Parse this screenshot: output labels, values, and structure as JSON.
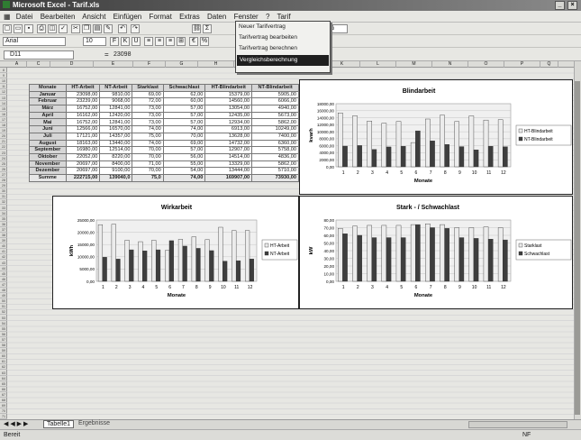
{
  "window": {
    "title": "Microsoft Excel - Tarif.xls",
    "min": "_",
    "close": "×"
  },
  "menu": {
    "items": [
      "Datei",
      "Bearbeiten",
      "Ansicht",
      "Einfügen",
      "Format",
      "Extras",
      "Daten",
      "Fenster",
      "?",
      "Tarif"
    ]
  },
  "dropdown": {
    "items": [
      "Neuer Tarifvertrag",
      "Tarifvertrag bearbeiten",
      "Tarifvertrag berechnen",
      "Vergleichsberechnung"
    ],
    "selected_index": 3
  },
  "toolbar": {
    "font": "Arial",
    "size": "10",
    "zoom": "%"
  },
  "formula": {
    "cell": "D11",
    "fx": "=",
    "value": "23098"
  },
  "columns": [
    "A",
    "C",
    "D",
    "E",
    "F",
    "G",
    "H",
    "I",
    "J",
    "K",
    "L",
    "M",
    "N",
    "O",
    "P",
    "Q"
  ],
  "table": {
    "headers": [
      "Monate",
      "HT-Arbeit",
      "NT-Arbeit",
      "Starklast",
      "Schwachlast",
      "HT-Blindarbeit",
      "NT-Blindarbeit"
    ],
    "rows": [
      [
        "Januar",
        "23098,00",
        "9810,00",
        "69,00",
        "62,00",
        "15379,00",
        "5905,00"
      ],
      [
        "Februar",
        "23239,00",
        "9068,00",
        "72,00",
        "60,00",
        "14560,00",
        "6066,00"
      ],
      [
        "März",
        "16752,00",
        "12841,00",
        "73,00",
        "57,00",
        "13054,00",
        "4940,00"
      ],
      [
        "April",
        "16162,00",
        "12420,00",
        "73,00",
        "57,00",
        "12435,00",
        "5673,00"
      ],
      [
        "Mai",
        "16752,00",
        "12841,00",
        "73,00",
        "57,00",
        "12934,00",
        "5862,00"
      ],
      [
        "Juni",
        "12566,00",
        "16570,00",
        "74,00",
        "74,00",
        "6913,00",
        "10249,00"
      ],
      [
        "Juli",
        "17121,00",
        "14357,00",
        "75,00",
        "70,00",
        "13628,00",
        "7400,00"
      ],
      [
        "August",
        "18163,00",
        "13440,00",
        "74,00",
        "69,00",
        "14732,00",
        "6360,00"
      ],
      [
        "September",
        "16980,00",
        "12514,00",
        "70,00",
        "57,00",
        "12907,00",
        "5758,00"
      ],
      [
        "Oktober",
        "22052,00",
        "8220,00",
        "70,00",
        "56,00",
        "14514,00",
        "4836,00"
      ],
      [
        "November",
        "20697,00",
        "8400,00",
        "71,00",
        "55,00",
        "13329,00",
        "5862,00"
      ],
      [
        "Dezember",
        "20697,00",
        "9100,00",
        "70,00",
        "54,00",
        "13444,00",
        "5710,00"
      ]
    ],
    "sum": [
      "Summe",
      "222715,00",
      "139040,0",
      "75,0",
      "74,00",
      "169907,00",
      "73930,00"
    ]
  },
  "chart_data": [
    {
      "type": "bar",
      "title": "Blindarbeit",
      "xlabel": "Monate",
      "ylabel": "kvarh",
      "categories": [
        "1",
        "2",
        "3",
        "4",
        "5",
        "6",
        "7",
        "8",
        "9",
        "10",
        "11",
        "12"
      ],
      "ylim": [
        0,
        18000
      ],
      "yticks": [
        "0,00",
        "2000,00",
        "4000,00",
        "6000,00",
        "8000,00",
        "10000,00",
        "12000,00",
        "14000,00",
        "16000,00",
        "18000,00"
      ],
      "series": [
        {
          "name": "HT-Blindarbeit",
          "values": [
            15379,
            14560,
            13054,
            12435,
            12934,
            6913,
            13628,
            14732,
            12907,
            14514,
            13329,
            13444
          ]
        },
        {
          "name": "NT-Blindarbeit",
          "values": [
            5905,
            6066,
            4940,
            5673,
            5862,
            10249,
            7400,
            6360,
            5758,
            4836,
            5862,
            5710
          ]
        }
      ]
    },
    {
      "type": "bar",
      "title": "Wirkarbeit",
      "xlabel": "Monate",
      "ylabel": "kWh",
      "categories": [
        "1",
        "2",
        "3",
        "4",
        "5",
        "6",
        "7",
        "8",
        "9",
        "10",
        "11",
        "12"
      ],
      "ylim": [
        0,
        25000
      ],
      "yticks": [
        "0,00",
        "5000,00",
        "10000,00",
        "15000,00",
        "20000,00",
        "25000,00"
      ],
      "series": [
        {
          "name": "HT-Arbeit",
          "values": [
            23098,
            23239,
            16752,
            16162,
            16752,
            12566,
            17121,
            18163,
            16980,
            22052,
            20697,
            20697
          ]
        },
        {
          "name": "NT-Arbeit",
          "values": [
            9810,
            9068,
            12841,
            12420,
            12841,
            16570,
            14357,
            13440,
            12514,
            8220,
            8400,
            9100
          ]
        }
      ]
    },
    {
      "type": "bar",
      "title": "Stark - / Schwachlast",
      "xlabel": "Monate",
      "ylabel": "kW",
      "categories": [
        "1",
        "2",
        "3",
        "4",
        "5",
        "6",
        "7",
        "8",
        "9",
        "10",
        "11",
        "12"
      ],
      "ylim": [
        0,
        80
      ],
      "yticks": [
        "0,00",
        "10,00",
        "20,00",
        "30,00",
        "40,00",
        "50,00",
        "60,00",
        "70,00",
        "80,00"
      ],
      "series": [
        {
          "name": "Starklast",
          "values": [
            69,
            72,
            73,
            73,
            73,
            74,
            75,
            74,
            70,
            70,
            71,
            70
          ]
        },
        {
          "name": "Schwachlast",
          "values": [
            62,
            60,
            57,
            57,
            57,
            74,
            70,
            69,
            57,
            56,
            55,
            54
          ]
        }
      ]
    }
  ],
  "colors": {
    "light_bar": "#ececec",
    "dark_bar": "#3e3e3e"
  },
  "tabs": {
    "active": "Tabelle1",
    "other": "Ergebnisse"
  },
  "status": {
    "left": "Bereit",
    "right": "NF"
  }
}
